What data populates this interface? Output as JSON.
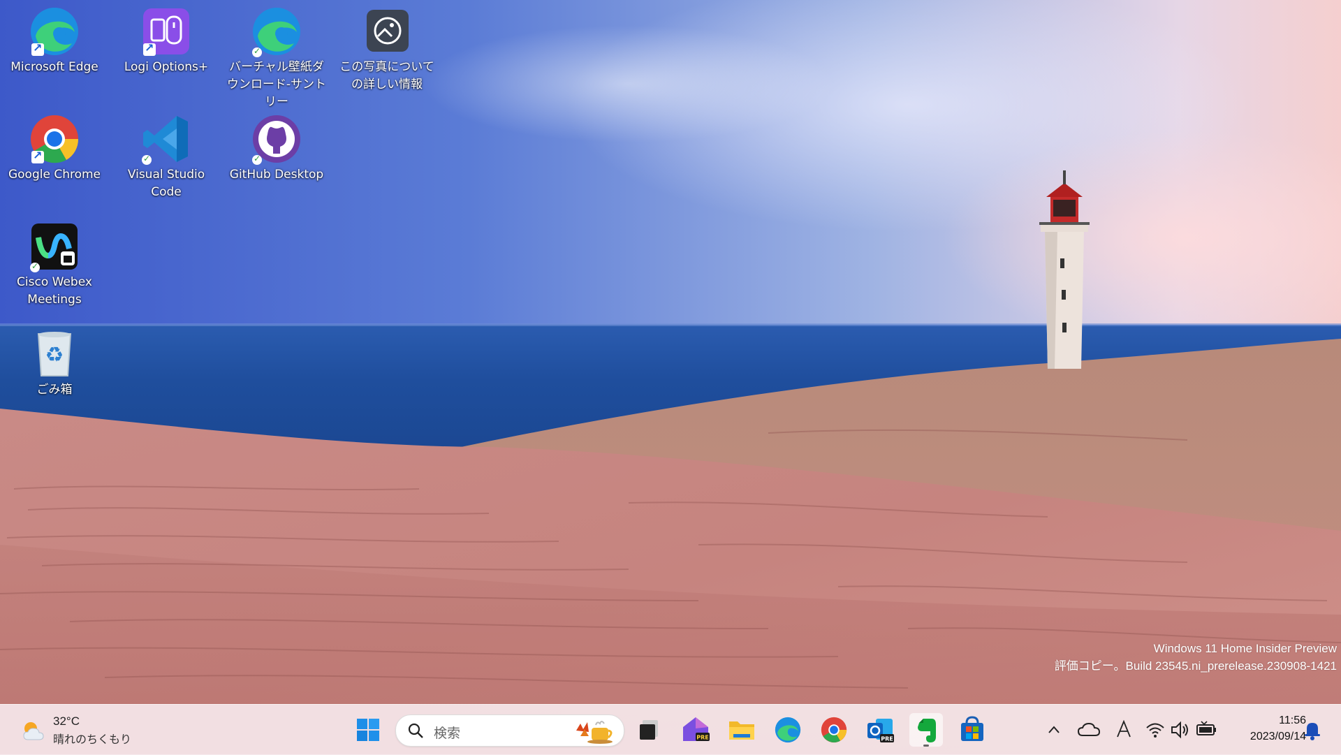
{
  "desktop": {
    "icons": [
      {
        "label": "Microsoft Edge"
      },
      {
        "label": "Logi Options+"
      },
      {
        "label": "バーチャル壁紙ダウンロード-サントリー"
      },
      {
        "label": "この写真についての詳しい情報"
      },
      {
        "label": "Google Chrome"
      },
      {
        "label": "Visual Studio Code"
      },
      {
        "label": "GitHub Desktop"
      },
      {
        "label": "Cisco Webex Meetings"
      },
      {
        "label": "ごみ箱"
      }
    ],
    "watermark": {
      "line1": "Windows 11 Home Insider Preview",
      "line2": "評価コピー。Build 23545.ni_prerelease.230908-1421"
    }
  },
  "taskbar": {
    "weather": {
      "temp": "32°C",
      "condition": "晴れのちくもり"
    },
    "search": {
      "placeholder": "検索"
    },
    "apps": [
      "start-icon",
      "task-view-icon",
      "dev-home-preview-icon",
      "file-explorer-icon",
      "edge-icon",
      "chrome-icon",
      "outlook-preview-icon",
      "evernote-icon",
      "microsoft-store-icon"
    ],
    "tray": [
      "chevron-up-icon",
      "onedrive-icon",
      "ime-icon",
      "wifi-icon",
      "volume-icon",
      "battery-icon"
    ],
    "clock": {
      "time": "11:56",
      "date": "2023/09/14"
    }
  },
  "colors": {
    "sky": "#5b7cd6",
    "sea": "#1f4e9d",
    "sand": "#c98a84",
    "taskbar": "#f6e8ec"
  }
}
